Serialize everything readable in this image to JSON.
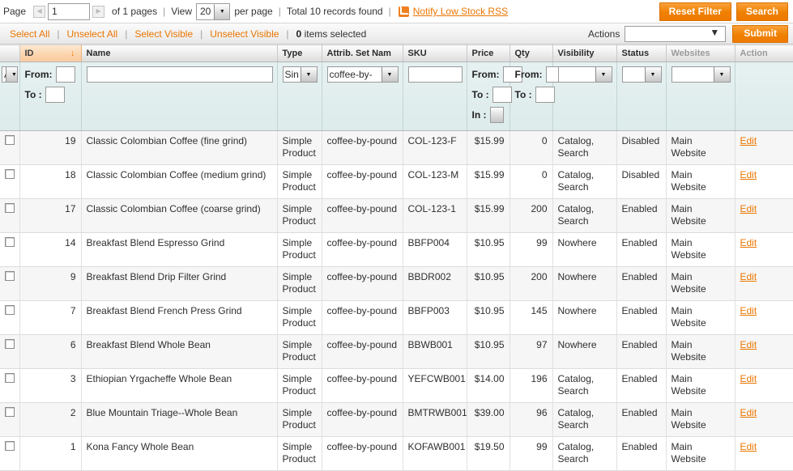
{
  "pager": {
    "page_label": "Page",
    "page_value": "1",
    "of_pages": "of 1 pages",
    "view_label": "View",
    "per_page_value": "20",
    "per_page_label": "per page",
    "total_records": "Total 10 records found",
    "rss_link": "Notify Low Stock RSS",
    "prev_icon": "prev-page-icon",
    "next_icon": "next-page-icon",
    "reset_filter_label": "Reset Filter",
    "search_label": "Search"
  },
  "massaction": {
    "select_all": "Select All",
    "unselect_all": "Unselect All",
    "select_visible": "Select Visible",
    "unselect_visible": "Unselect Visible",
    "selected_count": "0",
    "selected_text": "items selected",
    "actions_label": "Actions",
    "actions_value": "",
    "submit_label": "Submit"
  },
  "columns": [
    {
      "key": "checkbox",
      "label": "",
      "sorted": false,
      "muted": false
    },
    {
      "key": "id",
      "label": "ID",
      "sorted": true,
      "muted": false
    },
    {
      "key": "name",
      "label": "Name",
      "sorted": false,
      "muted": false
    },
    {
      "key": "type",
      "label": "Type",
      "sorted": false,
      "muted": false
    },
    {
      "key": "attrib_set",
      "label": "Attrib. Set Nam",
      "sorted": false,
      "muted": false
    },
    {
      "key": "sku",
      "label": "SKU",
      "sorted": false,
      "muted": false
    },
    {
      "key": "price",
      "label": "Price",
      "sorted": false,
      "muted": false
    },
    {
      "key": "qty",
      "label": "Qty",
      "sorted": false,
      "muted": false
    },
    {
      "key": "visibility",
      "label": "Visibility",
      "sorted": false,
      "muted": false
    },
    {
      "key": "status",
      "label": "Status",
      "sorted": false,
      "muted": false
    },
    {
      "key": "websites",
      "label": "Websites",
      "sorted": false,
      "muted": true
    },
    {
      "key": "action",
      "label": "Action",
      "sorted": false,
      "muted": true
    }
  ],
  "sort": {
    "column": "ID",
    "direction": "desc",
    "arrow": "↓"
  },
  "filters": {
    "checkbox_select_value": "Any",
    "id_from_label": "From:",
    "id_from_value": "",
    "id_to_label": "To :",
    "id_to_value": "",
    "name_value": "",
    "type_value": "Sin",
    "attrib_set_value": "coffee-by-",
    "sku_value": "",
    "price_from_label": "From:",
    "price_from_value": "",
    "price_to_label": "To :",
    "price_to_value": "",
    "price_in_label": "In :",
    "price_in_value": "",
    "qty_from_label": "From:",
    "qty_from_value": "",
    "qty_to_label": "To :",
    "qty_to_value": "",
    "visibility_value": "",
    "status_value": "",
    "websites_value": ""
  },
  "rows": [
    {
      "id": "19",
      "name": "Classic Colombian Coffee (fine grind)",
      "type": "Simple Product",
      "attrib_set": "coffee-by-pound",
      "sku": "COL-123-F",
      "price": "$15.99",
      "qty": "0",
      "visibility": "Catalog, Search",
      "status": "Disabled",
      "websites": "Main Website",
      "action": "Edit"
    },
    {
      "id": "18",
      "name": "Classic Colombian Coffee (medium grind)",
      "type": "Simple Product",
      "attrib_set": "coffee-by-pound",
      "sku": "COL-123-M",
      "price": "$15.99",
      "qty": "0",
      "visibility": "Catalog, Search",
      "status": "Disabled",
      "websites": "Main Website",
      "action": "Edit"
    },
    {
      "id": "17",
      "name": "Classic Colombian Coffee (coarse grind)",
      "type": "Simple Product",
      "attrib_set": "coffee-by-pound",
      "sku": "COL-123-1",
      "price": "$15.99",
      "qty": "200",
      "visibility": "Catalog, Search",
      "status": "Enabled",
      "websites": "Main Website",
      "action": "Edit"
    },
    {
      "id": "14",
      "name": "Breakfast Blend Espresso Grind",
      "type": "Simple Product",
      "attrib_set": "coffee-by-pound",
      "sku": "BBFP004",
      "price": "$10.95",
      "qty": "99",
      "visibility": "Nowhere",
      "status": "Enabled",
      "websites": "Main Website",
      "action": "Edit"
    },
    {
      "id": "9",
      "name": "Breakfast Blend Drip Filter Grind",
      "type": "Simple Product",
      "attrib_set": "coffee-by-pound",
      "sku": "BBDR002",
      "price": "$10.95",
      "qty": "200",
      "visibility": "Nowhere",
      "status": "Enabled",
      "websites": "Main Website",
      "action": "Edit"
    },
    {
      "id": "7",
      "name": "Breakfast Blend French Press Grind",
      "type": "Simple Product",
      "attrib_set": "coffee-by-pound",
      "sku": "BBFP003",
      "price": "$10.95",
      "qty": "145",
      "visibility": "Nowhere",
      "status": "Enabled",
      "websites": "Main Website",
      "action": "Edit"
    },
    {
      "id": "6",
      "name": "Breakfast Blend Whole Bean",
      "type": "Simple Product",
      "attrib_set": "coffee-by-pound",
      "sku": "BBWB001",
      "price": "$10.95",
      "qty": "97",
      "visibility": "Nowhere",
      "status": "Enabled",
      "websites": "Main Website",
      "action": "Edit"
    },
    {
      "id": "3",
      "name": "Ethiopian Yrgacheffe Whole Bean",
      "type": "Simple Product",
      "attrib_set": "coffee-by-pound",
      "sku": "YEFCWB001",
      "price": "$14.00",
      "qty": "196",
      "visibility": "Catalog, Search",
      "status": "Enabled",
      "websites": "Main Website",
      "action": "Edit"
    },
    {
      "id": "2",
      "name": "Blue Mountain Triage--Whole Bean",
      "type": "Simple Product",
      "attrib_set": "coffee-by-pound",
      "sku": "BMTRWB001",
      "price": "$39.00",
      "qty": "96",
      "visibility": "Catalog, Search",
      "status": "Enabled",
      "websites": "Main Website",
      "action": "Edit"
    },
    {
      "id": "1",
      "name": "Kona Fancy Whole Bean",
      "type": "Simple Product",
      "attrib_set": "coffee-by-pound",
      "sku": "KOFAWB001",
      "price": "$19.50",
      "qty": "99",
      "visibility": "Catalog, Search",
      "status": "Enabled",
      "websites": "Main Website",
      "action": "Edit"
    }
  ],
  "colors": {
    "accent_orange": "#ea7601",
    "button_orange": "#f08000",
    "filter_row_bg": "#d9e9e9",
    "sorted_header_bg": "#fbd4ad"
  }
}
